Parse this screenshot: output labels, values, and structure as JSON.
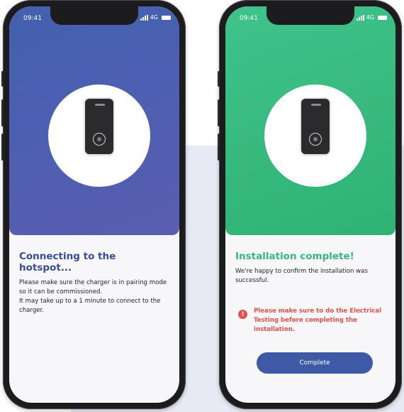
{
  "colors": {
    "left_accent": "#4a5fb0",
    "right_accent": "#38ba7f",
    "warning": "#e5514c",
    "button": "#3e5aa7"
  },
  "left_phone": {
    "status": {
      "time": "09:41",
      "network": "4G"
    },
    "title": "Connecting to the hotspot...",
    "paragraphs": [
      "Please make sure the charger is in pairing mode so it can be commissioned.",
      "It may take up to a 1 minute to connect to the charger."
    ]
  },
  "right_phone": {
    "status": {
      "time": "09:41",
      "network": "4G"
    },
    "title": "Installation complete!",
    "paragraph": "We're happy to confirm the installation was successful.",
    "warning": "Please make sure to do the Electrical Testing before completing the installation.",
    "warning_icon": "!",
    "button_label": "Complete"
  }
}
